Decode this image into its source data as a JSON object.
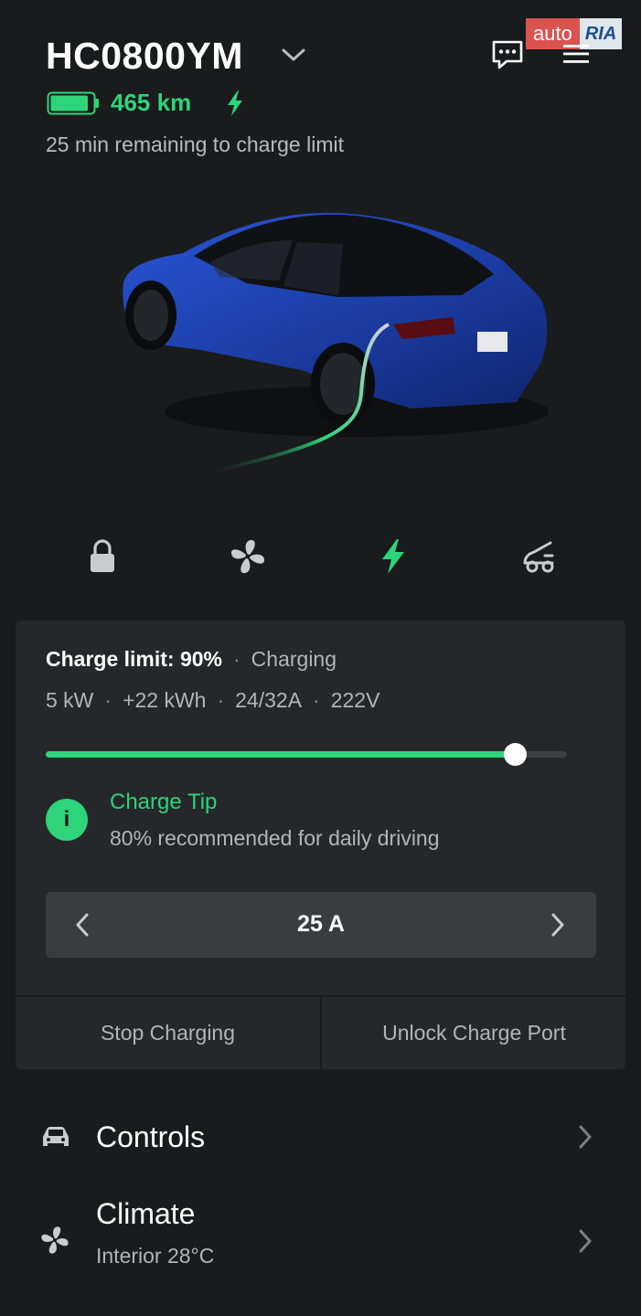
{
  "header": {
    "vehicle_name": "HC0800YM",
    "range": "465 km",
    "charge_status": "25 min remaining to charge limit",
    "battery_level": 0.9
  },
  "watermark": {
    "part1": "auto",
    "part2": "RIA"
  },
  "quick_actions": [
    "lock-icon",
    "fan-icon",
    "charging-bolt-icon",
    "trunk-icon"
  ],
  "charging": {
    "limit_label": "Charge limit: 90%",
    "state": "Charging",
    "power": "5 kW",
    "energy_added": "+22 kWh",
    "current": "24/32A",
    "voltage": "222V",
    "limit_fraction": 0.9,
    "tip_title": "Charge Tip",
    "tip_body": "80% recommended for daily driving",
    "tip_icon_glyph": "i",
    "amps": "25 A",
    "stop_label": "Stop Charging",
    "unlock_label": "Unlock Charge Port"
  },
  "menu": {
    "controls": {
      "label": "Controls"
    },
    "climate": {
      "label": "Climate",
      "sub": "Interior 28°C"
    }
  },
  "colors": {
    "accent": "#2ed47a",
    "background": "#1a1b1d",
    "card": "#25272a",
    "car_body": "#1c3fa8"
  }
}
